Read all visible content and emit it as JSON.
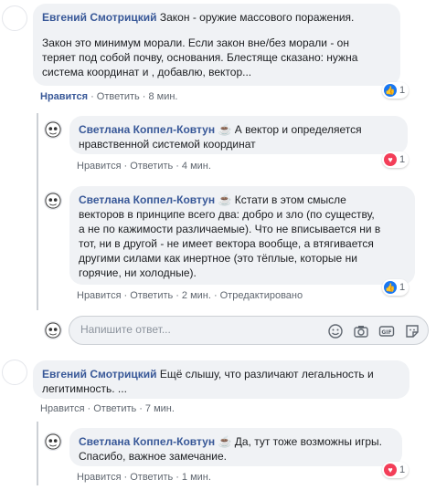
{
  "colors": {
    "link": "#385898",
    "bubble": "#f0f2f5",
    "meta": "#606770",
    "like": "#1877f2",
    "love": "#f33e58"
  },
  "comments": [
    {
      "author": "Евгений Смотрицкий",
      "lines": [
        "Закон - оружие массового поражения.",
        "",
        "Закон это минимум морали. Если закон вне/без морали - он",
        "теряет под собой почву, основания. Блестяще сказано: нужна",
        "система координат и , добавлю, вектор..."
      ],
      "like": "Нравится",
      "reply": "Ответить",
      "time": "8 мин.",
      "reaction": {
        "icon": "like-icon",
        "count": "1"
      }
    },
    {
      "author": "Светлана Коппел-Ковтун",
      "lines": [
        "А вектор и определяется",
        "нравственной системой координат"
      ],
      "like": "Нравится",
      "reply": "Ответить",
      "time": "4 мин.",
      "reaction": {
        "icon": "love-icon",
        "count": "1"
      }
    },
    {
      "author": "Светлана Коппел-Ковтун",
      "lines": [
        "Кстати в этом смысле",
        "векторов в принципе всего два: добро и зло (по существу,",
        "а не по кажимости различаемые). Что не вписывается ни в",
        "тот, ни в другой - не имеет вектора вообще, а втягивается",
        "другими силами как инертное (это тёплые, которые ни",
        "горячие, ни холодные)."
      ],
      "like": "Нравится",
      "reply": "Ответить",
      "time": "2 мин.",
      "edited": "Отредактировано",
      "reaction": {
        "icon": "like-icon",
        "count": "1"
      }
    },
    {
      "author": "Евгений Смотрицкий",
      "lines": [
        "Ещё слышу, что различают легальность и",
        "легитимность. ..."
      ],
      "like": "Нравится",
      "reply": "Ответить",
      "time": "7 мин."
    },
    {
      "author": "Светлана Коппел-Ковтун",
      "lines": [
        "Да, тут тоже возможны игры.",
        "Спасибо, важное замечание."
      ],
      "like": "Нравится",
      "reply": "Ответить",
      "time": "1 мин.",
      "reaction": {
        "icon": "love-icon",
        "count": "1"
      }
    }
  ],
  "reply_box": {
    "placeholder": "Напишите ответ...",
    "icons": [
      "emoji-icon",
      "camera-icon",
      "gif-icon",
      "sticker-icon"
    ]
  },
  "author_badge": "coffee-icon"
}
